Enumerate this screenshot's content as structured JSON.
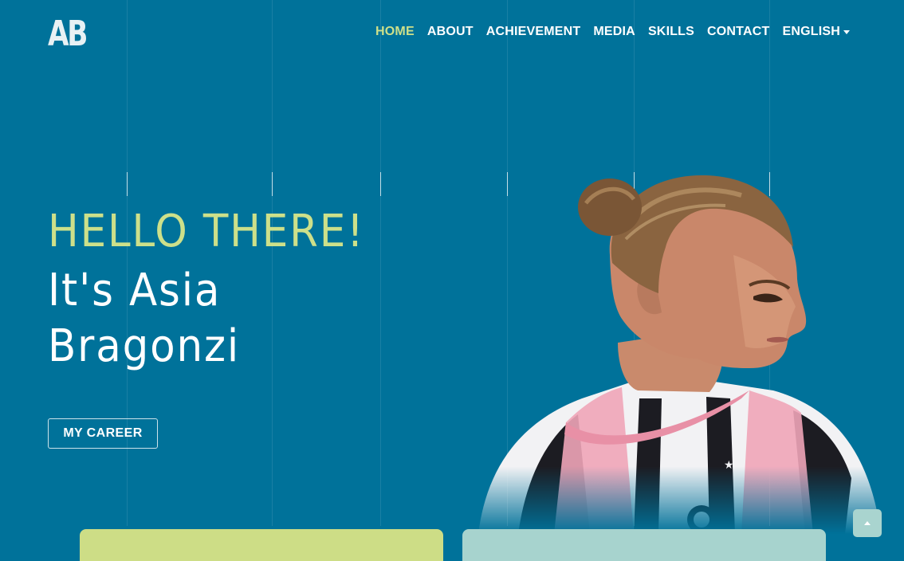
{
  "brand": {
    "logo_text": "AB"
  },
  "nav": {
    "items": [
      {
        "label": "HOME",
        "active": true
      },
      {
        "label": "ABOUT",
        "active": false
      },
      {
        "label": "ACHIEVEMENT",
        "active": false
      },
      {
        "label": "MEDIA",
        "active": false
      },
      {
        "label": "SKILLS",
        "active": false
      },
      {
        "label": "CONTACT",
        "active": false
      }
    ],
    "language": {
      "label": "ENGLISH"
    }
  },
  "hero": {
    "greeting": "HELLO THERE!",
    "name_line1": "It's Asia",
    "name_line2": "Bragonzi",
    "cta_label": "MY CAREER"
  },
  "colors": {
    "background": "#00729a",
    "accent": "#cde08a",
    "card_left": "#cddd86",
    "card_right": "#a7d3ce"
  },
  "icons": {
    "scroll_top": "chevron-up-icon",
    "language_dropdown": "caret-down-icon"
  }
}
